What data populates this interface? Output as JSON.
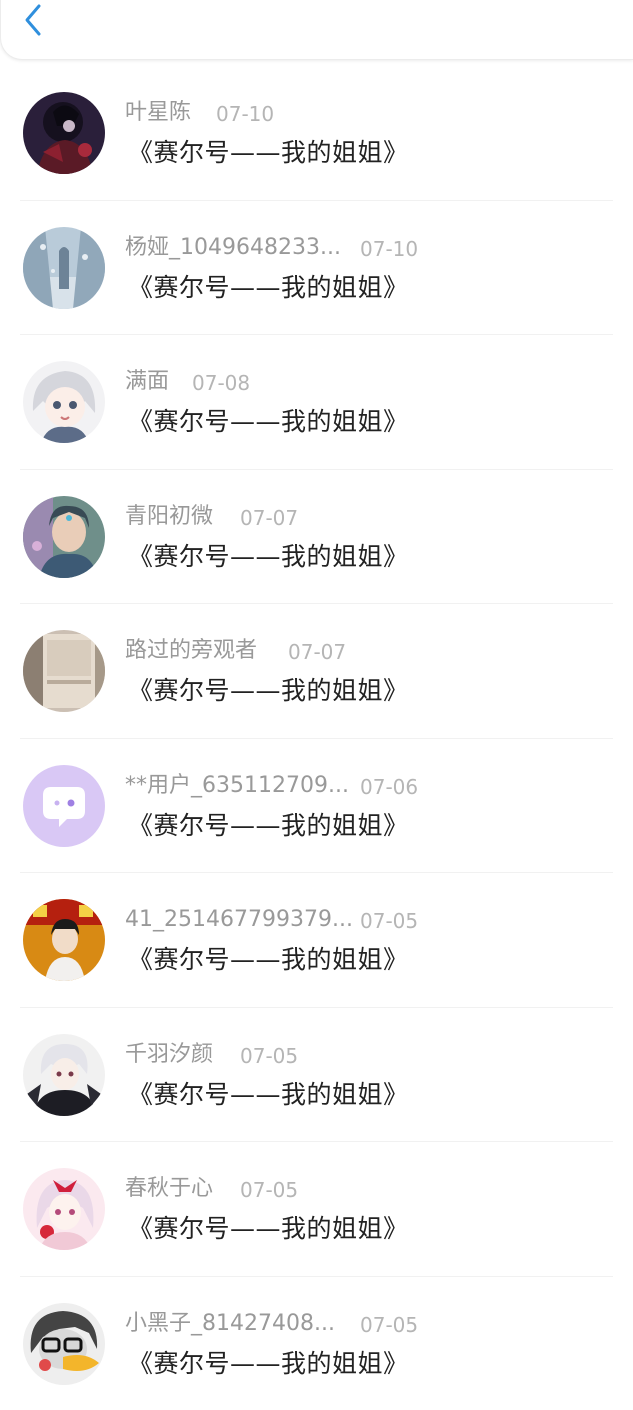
{
  "header": {
    "back_icon": "chevron-left-icon",
    "accent_color": "#2f8fdd"
  },
  "rows": [
    {
      "name": "叶星陈",
      "date": "07-10",
      "message": "《赛尔号——我的姐姐》"
    },
    {
      "name": "杨娅_1049648233...",
      "date": "07-10",
      "message": "《赛尔号——我的姐姐》"
    },
    {
      "name": "满面",
      "date": "07-08",
      "message": "《赛尔号——我的姐姐》"
    },
    {
      "name": "青阳初微",
      "date": "07-07",
      "message": "《赛尔号——我的姐姐》"
    },
    {
      "name": "路过的旁观者",
      "date": "07-07",
      "message": "《赛尔号——我的姐姐》"
    },
    {
      "name": "**用户_635112709...",
      "date": "07-06",
      "message": "《赛尔号——我的姐姐》"
    },
    {
      "name": "41_251467799379...",
      "date": "07-05",
      "message": "《赛尔号——我的姐姐》"
    },
    {
      "name": "千羽汐颜",
      "date": "07-05",
      "message": "《赛尔号——我的姐姐》"
    },
    {
      "name": "春秋于心",
      "date": "07-05",
      "message": "《赛尔号——我的姐姐》"
    },
    {
      "name": "小黑子_81427408...",
      "date": "07-05",
      "message": "《赛尔号——我的姐姐》"
    }
  ]
}
